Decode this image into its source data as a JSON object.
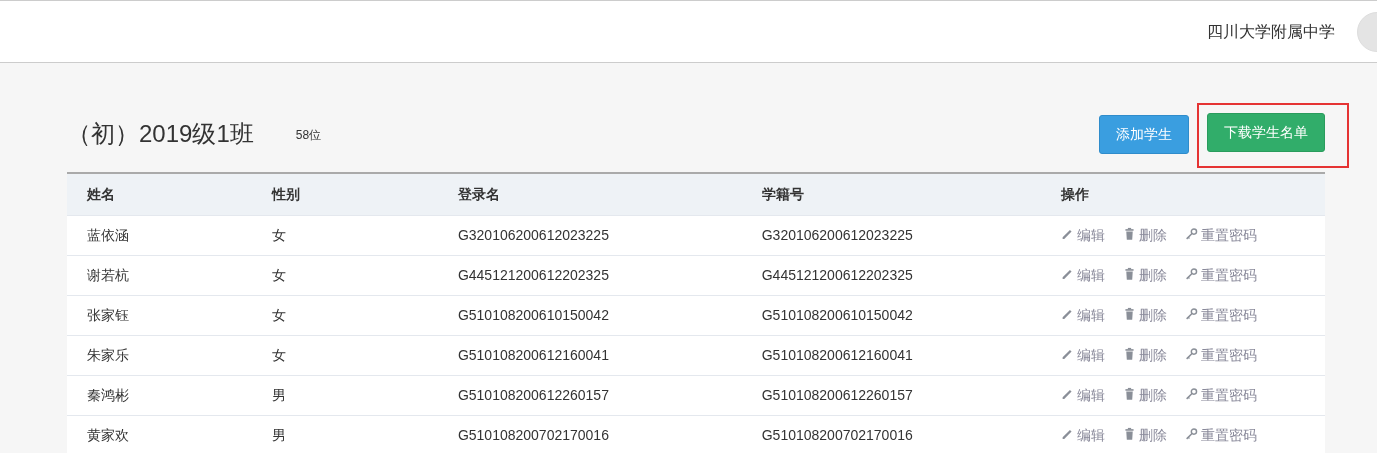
{
  "header": {
    "school": "四川大学附属中学"
  },
  "page": {
    "title": "（初）2019级1班",
    "count": "58位"
  },
  "buttons": [
    {
      "kind": "primary",
      "label": "添加学生",
      "highlighted": false
    },
    {
      "kind": "success",
      "label": "下载学生名单",
      "highlighted": true
    }
  ],
  "table": {
    "columns": [
      "姓名",
      "性别",
      "登录名",
      "学籍号",
      "操作"
    ],
    "rows": [
      {
        "cells": [
          "蓝依涵",
          "女",
          "G320106200612023225",
          "G320106200612023225"
        ],
        "actions": [
          {
            "kind": "edit",
            "label": "编辑"
          },
          {
            "kind": "delete",
            "label": "删除"
          },
          {
            "kind": "reset",
            "label": "重置密码"
          }
        ]
      },
      {
        "cells": [
          "谢若杭",
          "女",
          "G445121200612202325",
          "G445121200612202325"
        ],
        "actions": [
          {
            "kind": "edit",
            "label": "编辑"
          },
          {
            "kind": "delete",
            "label": "删除"
          },
          {
            "kind": "reset",
            "label": "重置密码"
          }
        ]
      },
      {
        "cells": [
          "张家钰",
          "女",
          "G510108200610150042",
          "G510108200610150042"
        ],
        "actions": [
          {
            "kind": "edit",
            "label": "编辑"
          },
          {
            "kind": "delete",
            "label": "删除"
          },
          {
            "kind": "reset",
            "label": "重置密码"
          }
        ]
      },
      {
        "cells": [
          "朱家乐",
          "女",
          "G510108200612160041",
          "G510108200612160041"
        ],
        "actions": [
          {
            "kind": "edit",
            "label": "编辑"
          },
          {
            "kind": "delete",
            "label": "删除"
          },
          {
            "kind": "reset",
            "label": "重置密码"
          }
        ]
      },
      {
        "cells": [
          "秦鸿彬",
          "男",
          "G510108200612260157",
          "G510108200612260157"
        ],
        "actions": [
          {
            "kind": "edit",
            "label": "编辑"
          },
          {
            "kind": "delete",
            "label": "删除"
          },
          {
            "kind": "reset",
            "label": "重置密码"
          }
        ]
      },
      {
        "cells": [
          "黄家欢",
          "男",
          "G510108200702170016",
          "G510108200702170016"
        ],
        "actions": [
          {
            "kind": "edit",
            "label": "编辑"
          },
          {
            "kind": "delete",
            "label": "删除"
          },
          {
            "kind": "reset",
            "label": "重置密码"
          }
        ]
      }
    ]
  }
}
